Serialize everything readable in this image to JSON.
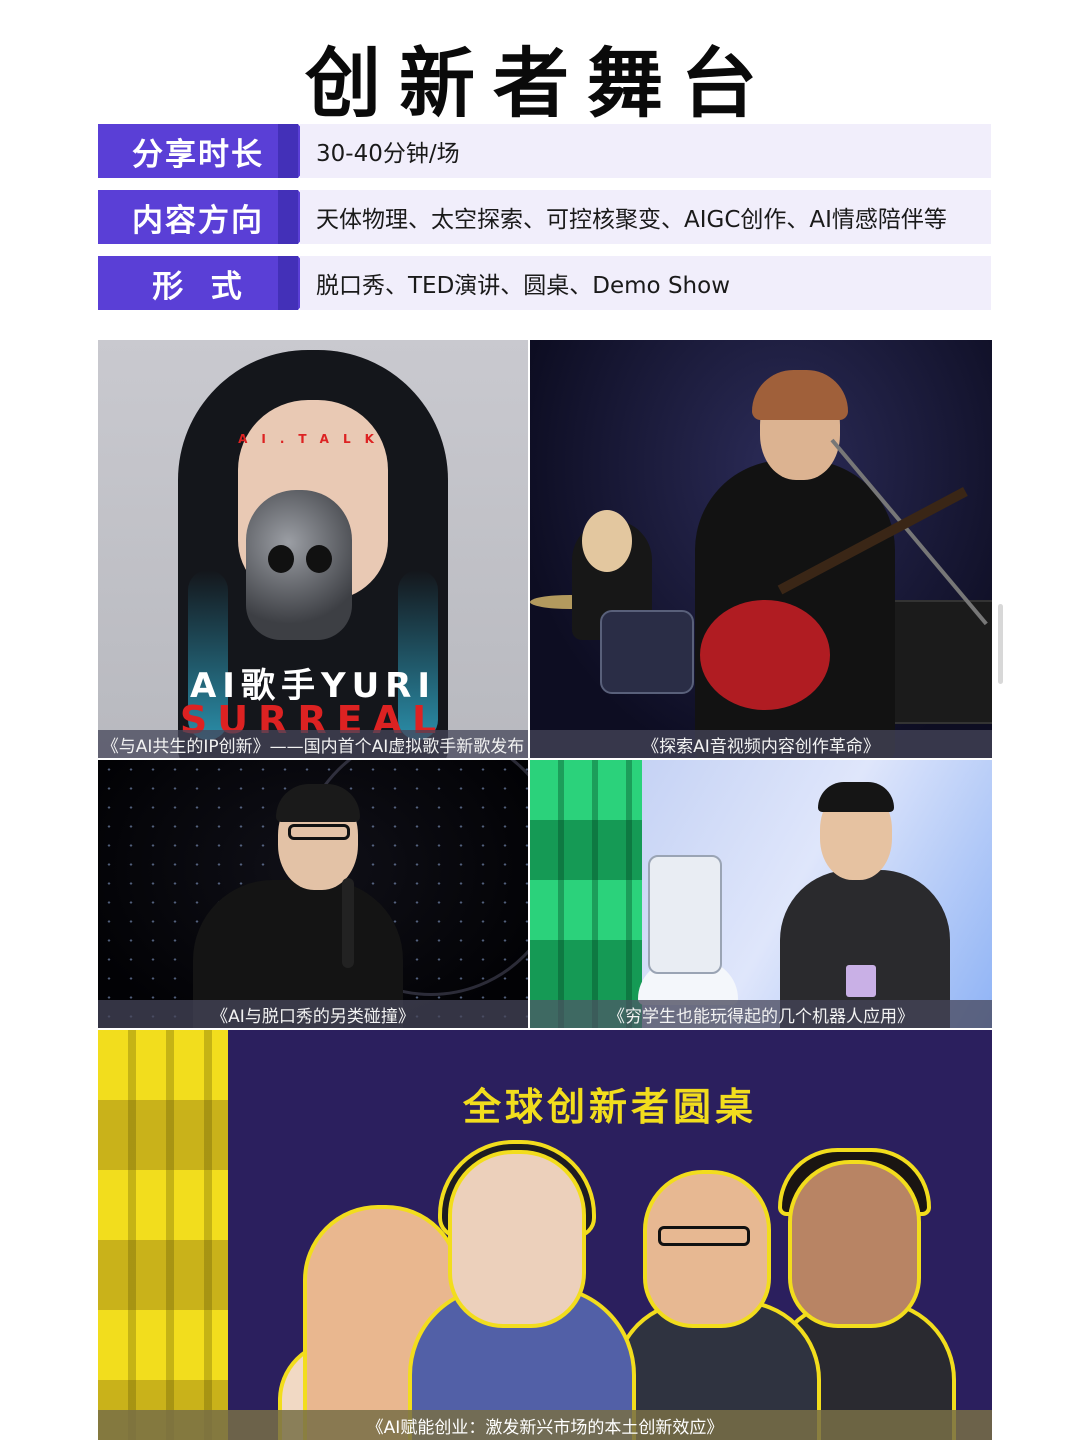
{
  "page": {
    "title": "创新者舞台"
  },
  "info": [
    {
      "label": "分享时长",
      "value": "30-40分钟/场"
    },
    {
      "label": "内容方向",
      "value": "天体物理、太空探索、可控核聚变、AIGC创作、AI情感陪伴等"
    },
    {
      "label": "形  式",
      "value": "脱口秀、TED演讲、圆桌、Demo Show"
    }
  ],
  "panels": {
    "yuri": {
      "brand_small": "AI.TALK",
      "headline": "AI歌手YURI",
      "brand_large": "SURREAL",
      "caption": "《与AI共生的IP创新》——国内首个AI虚拟歌手新歌发布"
    },
    "music": {
      "caption": "《探索AI音视频内容创作革命》"
    },
    "standup": {
      "caption": "《AI与脱口秀的另类碰撞》"
    },
    "robot": {
      "caption": "《穷学生也能玩得起的几个机器人应用》"
    },
    "roundtable": {
      "title": "全球创新者圆桌",
      "caption": "《AI赋能创业：激发新兴市场的本土创新效应》"
    }
  },
  "colors": {
    "accent": "#5a3fd6",
    "accent_light": "#f1eefb",
    "roundtable_bg": "#2b1f5e",
    "roundtable_title": "#f2dd1d"
  }
}
